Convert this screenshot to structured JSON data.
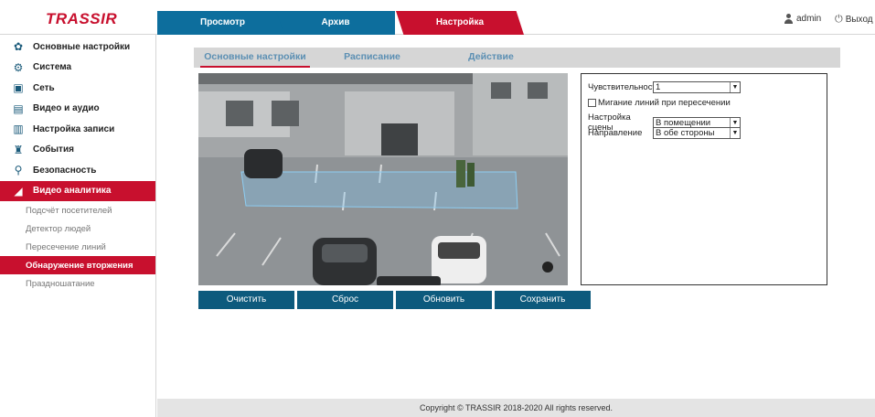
{
  "header": {
    "logo": "TRASSIR",
    "tabs": [
      "Просмотр",
      "Архив",
      "Настройка"
    ],
    "user": "admin",
    "logout": "Выход"
  },
  "sidebar": {
    "items": [
      {
        "label": "Основные настройки",
        "icon": "gear-icon"
      },
      {
        "label": "Система",
        "icon": "gears-icon"
      },
      {
        "label": "Сеть",
        "icon": "network-icon"
      },
      {
        "label": "Видео и аудио",
        "icon": "clapper-icon"
      },
      {
        "label": "Настройка записи",
        "icon": "save-icon"
      },
      {
        "label": "События",
        "icon": "event-icon"
      },
      {
        "label": "Безопасность",
        "icon": "security-icon"
      },
      {
        "label": "Видео аналитика",
        "icon": "analytics-icon"
      }
    ],
    "subitems": [
      "Подсчёт посетителей",
      "Детектор людей",
      "Пересечение линий",
      "Обнаружение вторжения",
      "Праздношатание"
    ]
  },
  "subtabs": [
    "Основные настройки",
    "Расписание",
    "Действие"
  ],
  "panel": {
    "sensitivity_label": "Чувствительность",
    "sensitivity_value": "1",
    "blink_label": "Мигание линий при пересечении",
    "scene_label": "Настройка сцены",
    "scene_value": "В помещении",
    "direction_label": "Направление",
    "direction_value": "В обе стороны"
  },
  "buttons": [
    "Очистить",
    "Сброс",
    "Обновить",
    "Сохранить"
  ],
  "footer": "Copyright © TRASSIR 2018-2020 All rights reserved.",
  "colors": {
    "accent": "#c8102e",
    "primary": "#0d6e9d",
    "button": "#0d5a7d"
  }
}
